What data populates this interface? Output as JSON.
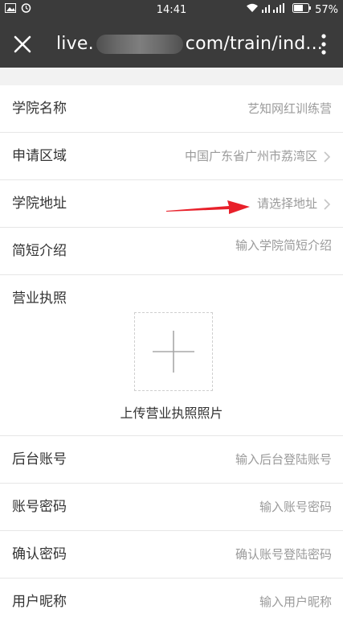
{
  "status_bar": {
    "time": "14:41",
    "battery": "57%",
    "icons_left": [
      "gallery-icon",
      "alarm-icon"
    ],
    "icons_right": [
      "wifi-icon",
      "signal-icon",
      "battery-icon"
    ]
  },
  "app_bar": {
    "url_prefix": "live.",
    "url_suffix": "com/train/ind...",
    "close_icon": "close-icon",
    "menu_icon": "more-vertical-icon"
  },
  "form": {
    "academy_name": {
      "label": "学院名称",
      "value": "艺知网红训练营"
    },
    "apply_region": {
      "label": "申请区域",
      "value": "中国广东省广州市荔湾区"
    },
    "academy_address": {
      "label": "学院地址",
      "placeholder": "请选择地址"
    },
    "short_intro": {
      "label": "简短介绍",
      "placeholder": "输入学院简短介绍"
    },
    "business_license": {
      "label": "营业执照",
      "upload_caption": "上传营业执照照片"
    },
    "backend_account": {
      "label": "后台账号",
      "placeholder": "输入后台登陆账号"
    },
    "account_password": {
      "label": "账号密码",
      "placeholder": "输入账号密码"
    },
    "confirm_password": {
      "label": "确认密码",
      "placeholder": "确认账号登陆密码"
    },
    "nickname": {
      "label": "用户昵称",
      "placeholder": "输入用户昵称"
    }
  },
  "colors": {
    "bar_bg": "#3b3b3b",
    "label": "#333333",
    "placeholder": "#9a9a9a",
    "divider": "#e6e6e6",
    "annotation_arrow": "#e8202a"
  }
}
